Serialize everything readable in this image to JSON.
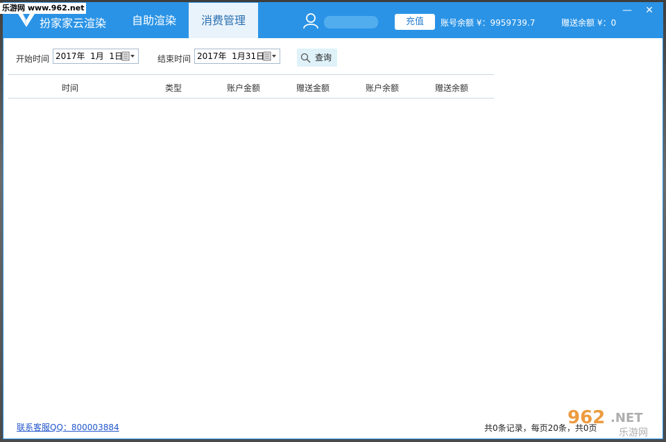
{
  "watermark": {
    "top_text": "乐游网 www.962.net",
    "bottom_brand": "962.NET",
    "bottom_sub": "乐游网"
  },
  "app": {
    "title": "扮家家云渲染"
  },
  "tabs": [
    {
      "label": "自助渲染",
      "active": false
    },
    {
      "label": "消费管理",
      "active": true
    }
  ],
  "header": {
    "recharge_label": "充值",
    "account_balance": "账号余额 ¥：9959739.7",
    "bonus_balance": "赠送余额 ¥：0"
  },
  "window_controls": {
    "minimize": "—",
    "close": "✕"
  },
  "filter": {
    "start_label": "开始时间",
    "start_value": "2017年  1月  1日",
    "end_label": "结束时间",
    "end_value": "2017年  1月31日",
    "query_label": "查询"
  },
  "table": {
    "columns": [
      "时间",
      "类型",
      "账户金额",
      "赠送金额",
      "账户余额",
      "赠送余额"
    ],
    "rows": []
  },
  "footer": {
    "support": "联系客服QQ：800003884",
    "pager": "共0条记录，每页20条，共0页"
  },
  "colors": {
    "titlebar": "#2a93e6",
    "active_tab_bg": "#e9f3fb",
    "link": "#2255cc",
    "query_bg": "#dff2fa"
  },
  "icons": [
    "logo-icon",
    "user-icon",
    "calendar-icon",
    "search-icon"
  ]
}
